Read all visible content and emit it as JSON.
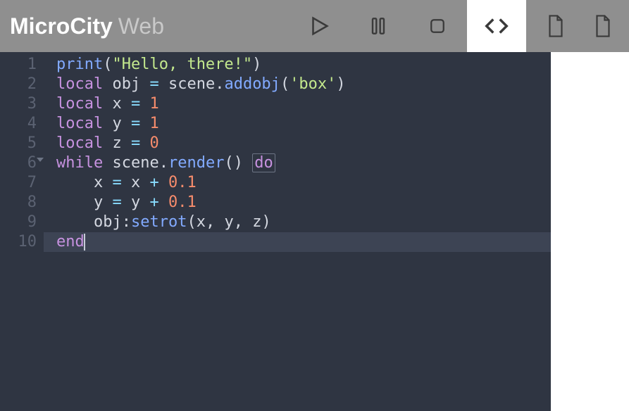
{
  "brand": {
    "bold": "MicroCity",
    "light": "Web"
  },
  "toolbar": {
    "play": "play-icon",
    "pause": "pause-icon",
    "stop": "stop-icon",
    "code": "code-icon",
    "file": "file-icon",
    "new": "file-plus-icon",
    "active": "code"
  },
  "editor": {
    "highlighted_line": 10,
    "fold_marker_line": 6,
    "lines": [
      {
        "n": 1,
        "tokens": [
          {
            "t": "print",
            "c": "tk-func"
          },
          {
            "t": "(",
            "c": "tk-punc"
          },
          {
            "t": "\"Hello, there!\"",
            "c": "tk-str"
          },
          {
            "t": ")",
            "c": "tk-punc"
          }
        ]
      },
      {
        "n": 2,
        "tokens": [
          {
            "t": "local ",
            "c": "tk-kw"
          },
          {
            "t": "obj ",
            "c": "tk-id"
          },
          {
            "t": "= ",
            "c": "tk-op"
          },
          {
            "t": "scene",
            "c": "tk-id"
          },
          {
            "t": ".",
            "c": "tk-punc"
          },
          {
            "t": "addobj",
            "c": "tk-func"
          },
          {
            "t": "(",
            "c": "tk-punc"
          },
          {
            "t": "'box'",
            "c": "tk-str"
          },
          {
            "t": ")",
            "c": "tk-punc"
          }
        ]
      },
      {
        "n": 3,
        "tokens": [
          {
            "t": "local ",
            "c": "tk-kw"
          },
          {
            "t": "x ",
            "c": "tk-id"
          },
          {
            "t": "= ",
            "c": "tk-op"
          },
          {
            "t": "1",
            "c": "tk-num"
          }
        ]
      },
      {
        "n": 4,
        "tokens": [
          {
            "t": "local ",
            "c": "tk-kw"
          },
          {
            "t": "y ",
            "c": "tk-id"
          },
          {
            "t": "= ",
            "c": "tk-op"
          },
          {
            "t": "1",
            "c": "tk-num"
          }
        ]
      },
      {
        "n": 5,
        "tokens": [
          {
            "t": "local ",
            "c": "tk-kw"
          },
          {
            "t": "z ",
            "c": "tk-id"
          },
          {
            "t": "= ",
            "c": "tk-op"
          },
          {
            "t": "0",
            "c": "tk-num"
          }
        ]
      },
      {
        "n": 6,
        "tokens": [
          {
            "t": "while ",
            "c": "tk-kw"
          },
          {
            "t": "scene",
            "c": "tk-id"
          },
          {
            "t": ".",
            "c": "tk-punc"
          },
          {
            "t": "render",
            "c": "tk-func"
          },
          {
            "t": "() ",
            "c": "tk-punc"
          },
          {
            "t": "do",
            "c": "tk-kw",
            "box": true
          }
        ]
      },
      {
        "n": 7,
        "tokens": [
          {
            "t": "    x ",
            "c": "tk-id"
          },
          {
            "t": "= ",
            "c": "tk-op"
          },
          {
            "t": "x ",
            "c": "tk-id"
          },
          {
            "t": "+ ",
            "c": "tk-op"
          },
          {
            "t": "0.1",
            "c": "tk-num"
          }
        ]
      },
      {
        "n": 8,
        "tokens": [
          {
            "t": "    y ",
            "c": "tk-id"
          },
          {
            "t": "= ",
            "c": "tk-op"
          },
          {
            "t": "y ",
            "c": "tk-id"
          },
          {
            "t": "+ ",
            "c": "tk-op"
          },
          {
            "t": "0.1",
            "c": "tk-num"
          }
        ]
      },
      {
        "n": 9,
        "tokens": [
          {
            "t": "    obj",
            "c": "tk-id"
          },
          {
            "t": ":",
            "c": "tk-punc"
          },
          {
            "t": "setrot",
            "c": "tk-func"
          },
          {
            "t": "(",
            "c": "tk-punc"
          },
          {
            "t": "x",
            "c": "tk-id"
          },
          {
            "t": ", ",
            "c": "tk-punc"
          },
          {
            "t": "y",
            "c": "tk-id"
          },
          {
            "t": ", ",
            "c": "tk-punc"
          },
          {
            "t": "z",
            "c": "tk-id"
          },
          {
            "t": ")",
            "c": "tk-punc"
          }
        ]
      },
      {
        "n": 10,
        "tokens": [
          {
            "t": "end",
            "c": "tk-kw"
          }
        ],
        "cursor_after": true
      }
    ]
  }
}
